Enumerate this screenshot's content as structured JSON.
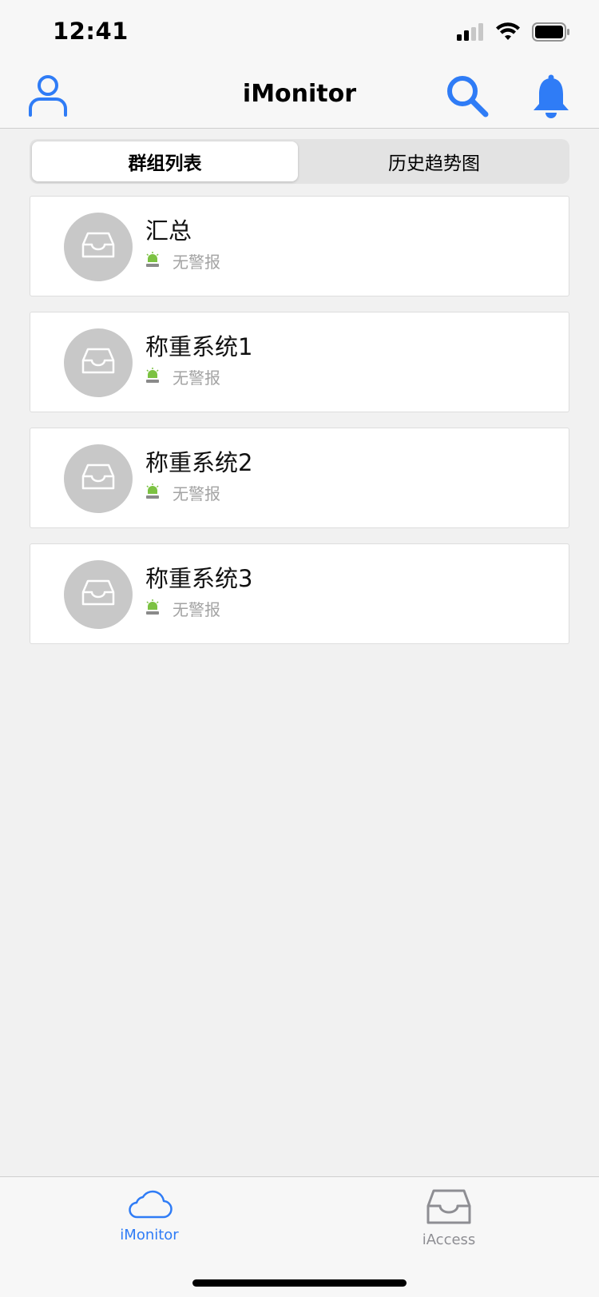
{
  "status_bar": {
    "time": "12:41"
  },
  "nav_bar": {
    "title": "iMonitor",
    "accent_color": "#2f7cf6"
  },
  "segmented_control": {
    "tabs": [
      {
        "label": "群组列表",
        "selected": true
      },
      {
        "label": "历史趋势图",
        "selected": false
      }
    ]
  },
  "groups": [
    {
      "name": "汇总",
      "alarm_status": "无警报",
      "icon": "inbox-tray-icon"
    },
    {
      "name": "称重系统1",
      "alarm_status": "无警报",
      "icon": "inbox-tray-icon"
    },
    {
      "name": "称重系统2",
      "alarm_status": "无警报",
      "icon": "inbox-tray-icon"
    },
    {
      "name": "称重系统3",
      "alarm_status": "无警报",
      "icon": "inbox-tray-icon"
    }
  ],
  "alarm_indicator_color": "#7cc242",
  "tab_bar": {
    "items": [
      {
        "label": "iMonitor",
        "icon": "cloud-icon",
        "active": true,
        "color": "#2f7cf6"
      },
      {
        "label": "iAccess",
        "icon": "inbox-tray-icon",
        "active": false,
        "color": "#8e8e93"
      }
    ]
  }
}
